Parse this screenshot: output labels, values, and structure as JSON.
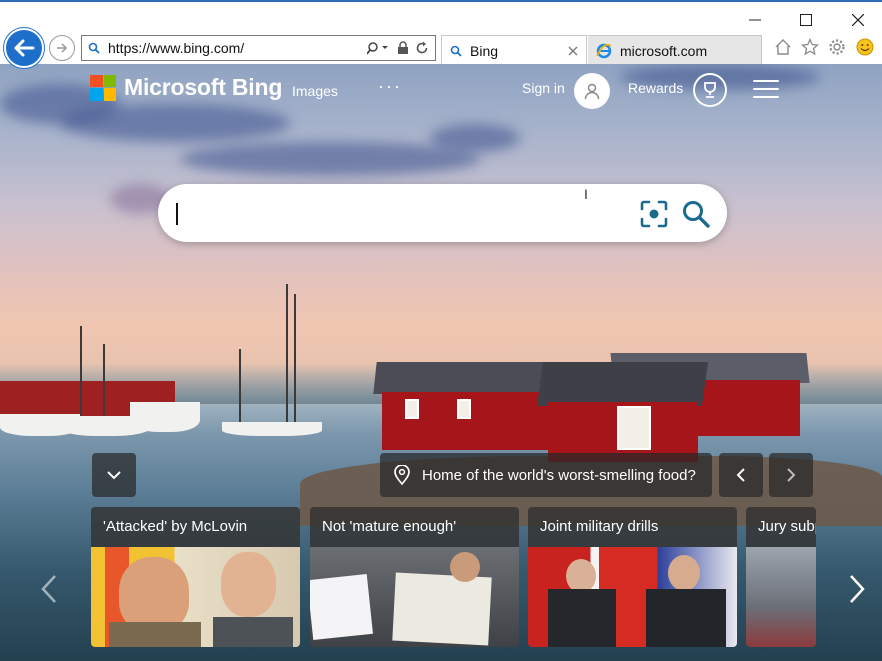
{
  "window": {
    "minimize_icon": "minimize-icon",
    "maximize_icon": "maximize-icon",
    "close_icon": "close-icon"
  },
  "address_bar": {
    "url": "https://www.bing.com/"
  },
  "tabs": [
    {
      "label": "Bing",
      "active": true
    },
    {
      "label": "microsoft.com",
      "active": false
    }
  ],
  "header": {
    "logo_text": "Microsoft Bing",
    "nav_images": "Images",
    "nav_more": "···",
    "sign_in": "Sign in",
    "rewards": "Rewards"
  },
  "search": {
    "value": "",
    "placeholder": ""
  },
  "info": {
    "text": "Home of the world's worst-smelling food?"
  },
  "news_cards": [
    {
      "title": "'Attacked' by McLovin"
    },
    {
      "title": "Not 'mature enough'"
    },
    {
      "title": "Joint military drills"
    },
    {
      "title": "Jury subp"
    }
  ],
  "colors": {
    "accent": "#1e6fc9",
    "ms_red": "#f25022",
    "ms_green": "#7fba00",
    "ms_blue": "#00a4ef",
    "ms_yellow": "#ffb900",
    "bing_teal": "#1b6b8f"
  }
}
